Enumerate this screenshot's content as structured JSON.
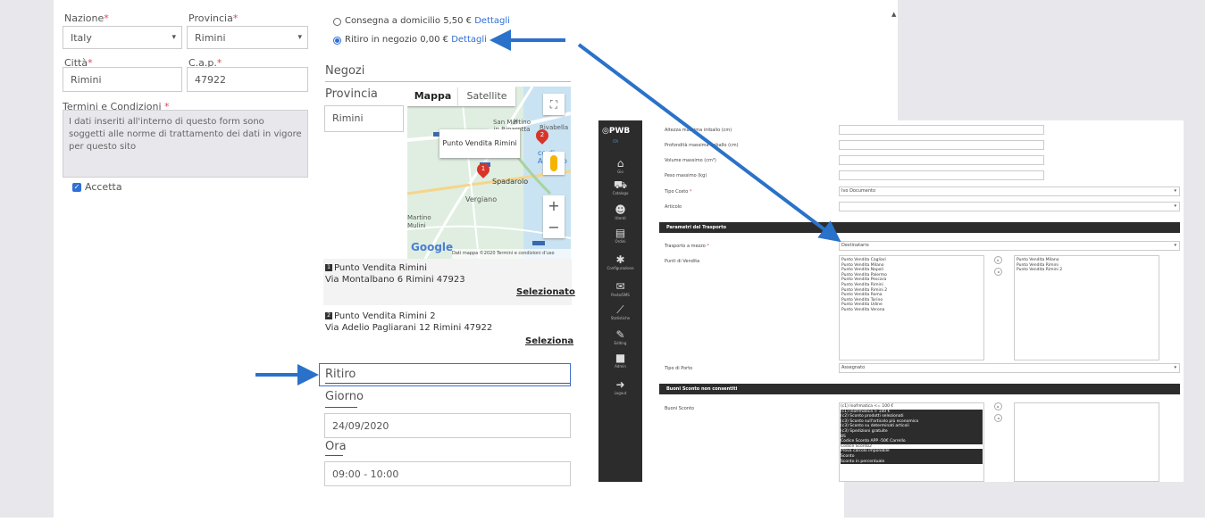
{
  "form": {
    "nazione_label": "Nazione",
    "nazione_value": "Italy",
    "provincia_label": "Provincia",
    "provincia_value": "Rimini",
    "citta_label": "Città",
    "citta_value": "Rimini",
    "cap_label": "C.a.p.",
    "cap_value": "47922",
    "required_mark": "*",
    "terms_label": "Termini e Condizioni",
    "terms_text": "I dati inseriti all'interno di questo form sono soggetti alle norme di trattamento dei dati in vigore per questo sito",
    "accept_label": "Accetta"
  },
  "shipping": {
    "option1_text": "Consegna a domicilio 5,50 €",
    "option1_link": "Dettagli",
    "option2_text": "Ritiro in negozio 0,00 €",
    "option2_link": "Dettagli"
  },
  "stores": {
    "title": "Negozi",
    "provincia_label": "Provincia",
    "provincia_value": "Rimini",
    "map": {
      "tab_map": "Mappa",
      "tab_satellite": "Satellite",
      "popup": "Punto Vendita Rimini",
      "place1": "San Martino in Riparotta",
      "place2": "Vergiano",
      "place3": "Spadarolo",
      "place4": "Martino Mulini",
      "place5": "Rivabella",
      "place6": "co di Augusto",
      "marker1": "1",
      "marker2": "2",
      "google": "Google",
      "footer": "Dati mappa ©2020   Termini e condizioni d'uso"
    },
    "items": [
      {
        "num": "1",
        "name": "Punto Vendita Rimini",
        "address": "Via Montalbano 6 Rimini 47923",
        "action": "Selezionato"
      },
      {
        "num": "2",
        "name": "Punto Vendita Rimini 2",
        "address": "Via Adelio Pagliarani 12 Rimini 47922",
        "action": "Seleziona"
      }
    ]
  },
  "pickup": {
    "title": "Ritiro",
    "giorno_label": "Giorno",
    "giorno_value": "24/09/2020",
    "ora_label": "Ora",
    "ora_value": "09:00 - 10:00"
  },
  "admin": {
    "logo": "PWB",
    "lang": "ITA",
    "sidebar": [
      {
        "icon": "home-icon",
        "glyph": "⌂",
        "label": "Gio"
      },
      {
        "icon": "truck-icon",
        "glyph": "⛟",
        "label": "Catalogo"
      },
      {
        "icon": "users-icon",
        "glyph": "☻",
        "label": "Utenti"
      },
      {
        "icon": "document-icon",
        "glyph": "▤",
        "label": "Ordini"
      },
      {
        "icon": "gear-icon",
        "glyph": "✱",
        "label": "Configurazione"
      },
      {
        "icon": "mail-icon",
        "glyph": "✉",
        "label": "Posta/SMS"
      },
      {
        "icon": "chart-icon",
        "glyph": "⟋",
        "label": "Statistiche"
      },
      {
        "icon": "pencil-icon",
        "glyph": "✎",
        "label": "Editing"
      },
      {
        "icon": "lock-icon",
        "glyph": "■",
        "label": "Admin"
      },
      {
        "icon": "logout-icon",
        "glyph": "➜",
        "label": "Logout"
      }
    ],
    "fields": {
      "altezza": "Altezza massima imballo (cm)",
      "profondita": "Profondità massima imballo (cm)",
      "volume": "Volume massimo (cm³)",
      "peso": "Peso massimo (kg)",
      "tipo_costo": "Tipo Costo",
      "tipo_costo_value": "Ivo Documento",
      "articolo": "Articolo"
    },
    "trasporto_header": "Parametri del Trasporto",
    "trasporto_label": "Trasporto a mezzo",
    "trasporto_value": "Destinatario",
    "punti_label": "Punti di Vendita",
    "punti_available": [
      "Punto Vendita Cagliari",
      "Punto Vendita Milano",
      "Punto Vendita Napoli",
      "Punto Vendita Palermo",
      "Punto Vendita Pescara",
      "Punto Vendita Rimini",
      "Punto Vendita Rimini 2",
      "Punto Vendita Roma",
      "Punto Vendita Torino",
      "Punto Vendita Udine",
      "Punto Vendita Verona"
    ],
    "punti_selected": [
      "Punto Vendita Milano",
      "Punto Vendita Rimini",
      "Punto Vendita Rimini 2"
    ],
    "porto_label": "Tipo di Porto",
    "porto_value": "Assegnato",
    "buoni_header": "Buoni Sconto non consentiti",
    "buoni_label": "Buoni Sconto",
    "buoni_list": [
      "(c1) Inofrmatica <= 100 €",
      "(c1) Inofrmatica > 100 €",
      "(c2) Sconto prodotti selezionati",
      "(c3) Sconto sull'articolo più economico",
      "(c3) Sconto su determinati articoli",
      "(c3) Spedizioni gratuite",
      "BS",
      "Codice Sconto APP -50€ Carrello",
      "Codice Sconto2",
      "Prova calcolo imponibile",
      "Sconto",
      "Sconto in percentuale"
    ],
    "buoni_highlight": [
      false,
      true,
      true,
      true,
      true,
      true,
      true,
      true,
      false,
      true,
      true,
      true
    ]
  }
}
